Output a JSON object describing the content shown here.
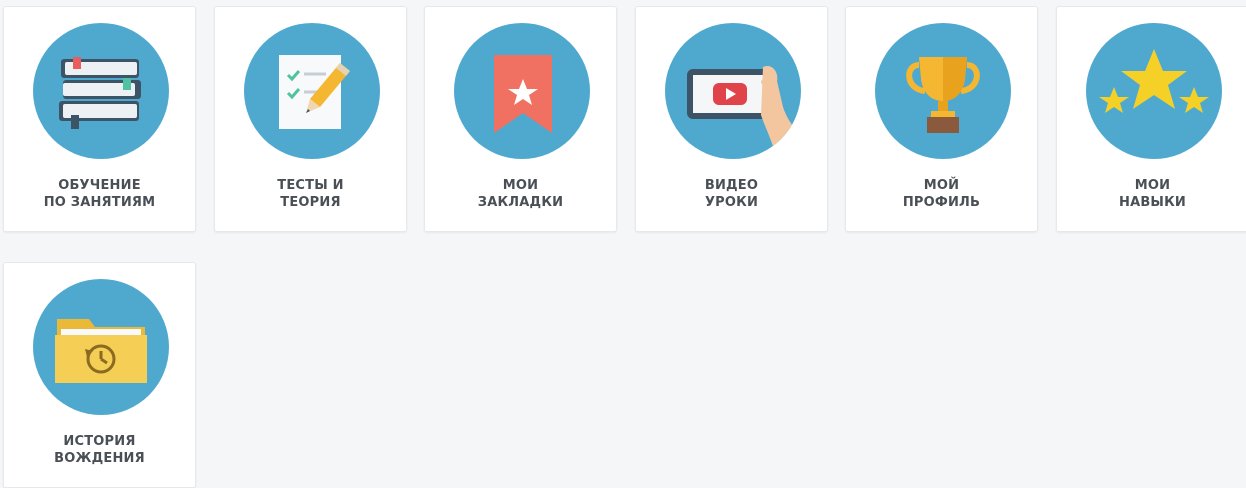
{
  "tiles": [
    {
      "id": "lessons",
      "icon": "books-icon",
      "line1": "ОБУЧЕНИЕ",
      "line2": "ПО ЗАНЯТИЯМ"
    },
    {
      "id": "tests",
      "icon": "checklist-pencil-icon",
      "line1": "ТЕСТЫ И",
      "line2": "ТЕОРИЯ"
    },
    {
      "id": "bookmarks",
      "icon": "bookmark-star-icon",
      "line1": "МОИ",
      "line2": "ЗАКЛАДКИ"
    },
    {
      "id": "video",
      "icon": "video-play-icon",
      "line1": "ВИДЕО",
      "line2": "УРОКИ"
    },
    {
      "id": "profile",
      "icon": "trophy-icon",
      "line1": "МОЙ",
      "line2": "ПРОФИЛЬ"
    },
    {
      "id": "skills",
      "icon": "stars-icon",
      "line1": "МОИ",
      "line2": "НАВЫКИ"
    },
    {
      "id": "history",
      "icon": "folder-history-icon",
      "line1": "ИСТОРИЯ",
      "line2": "ВОЖДЕНИЯ"
    }
  ],
  "colors": {
    "background": "#f4f6f8",
    "circle": "#4fa9cf",
    "label": "#4a4f55"
  }
}
